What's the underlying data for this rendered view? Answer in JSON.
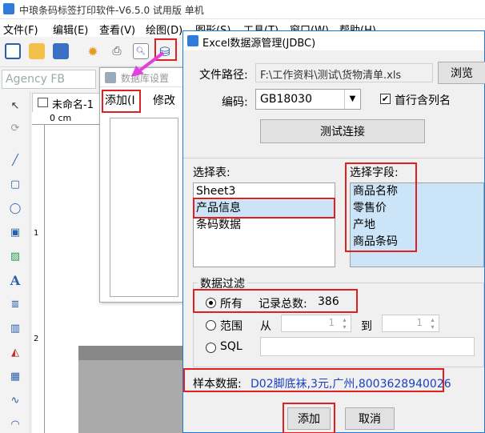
{
  "app": {
    "title": "中琅条码标签打印软件-V6.5.0 试用版 单机",
    "menu": [
      "文件(F)",
      "编辑(E)",
      "查看(V)",
      "绘图(D)",
      "图形(S)",
      "工具(T)",
      "窗口(W)",
      "帮助(H)"
    ],
    "font_name": "Agency FB",
    "doc_tab": "未命名-1",
    "ruler_unit": "0 cm",
    "ruler_marks": [
      "1",
      "2"
    ]
  },
  "db_dialog": {
    "title": "数据库设置",
    "add_label": "添加(I",
    "edit_label": "修改"
  },
  "excel_dialog": {
    "title": "Excel数据源管理(JDBC)",
    "file_path_label": "文件路径:",
    "file_path_value": "F:\\工作资料\\测试\\货物清单.xls",
    "browse_label": "浏览",
    "encoding_label": "编码:",
    "encoding_value": "GB18030",
    "first_row_label": "首行含列名",
    "test_label": "测试连接",
    "select_table_label": "选择表:",
    "tables": [
      "Sheet3",
      "产品信息",
      "条码数据"
    ],
    "selected_table_index": 1,
    "select_field_label": "选择字段:",
    "fields": [
      "商品名称",
      "零售价",
      "产地",
      "商品条码"
    ],
    "filter_title": "数据过滤",
    "filter_all_label": "所有",
    "record_count_label": "记录总数:",
    "record_count": "386",
    "filter_range_label": "范围",
    "from_label": "从",
    "from_value": "1",
    "to_label": "到",
    "to_value": "1",
    "filter_sql_label": "SQL",
    "sample_label": "样本数据:",
    "sample_value": "D02脚底袜,3元,广州,8003628940026",
    "add_button": "添加",
    "cancel_button": "取消"
  },
  "colors": {
    "highlight": "#e02020",
    "accent": "#1d7ad6",
    "selection": "#cce4f7",
    "sample_text": "#1a3fc2",
    "arrow": "#e040e0"
  }
}
